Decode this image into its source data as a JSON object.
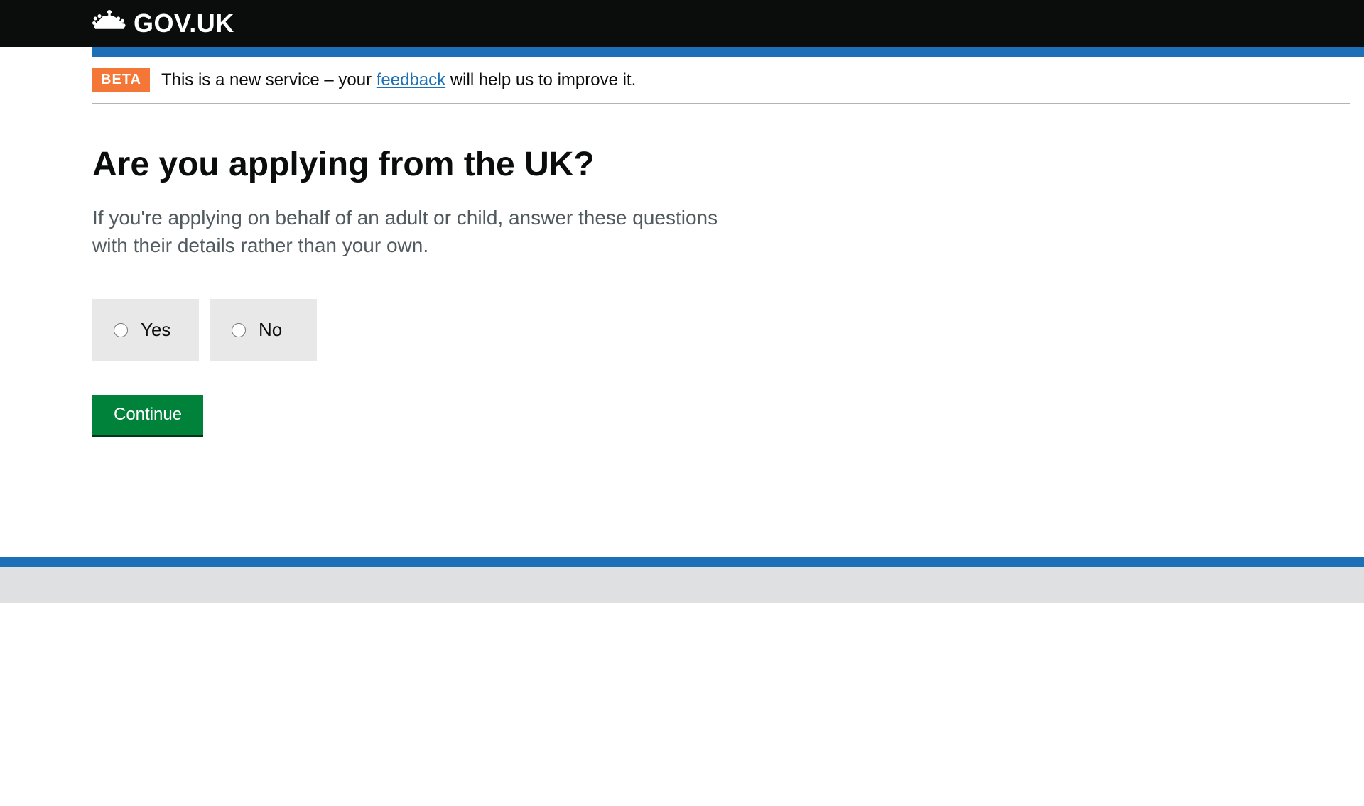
{
  "header": {
    "site_name": "GOV.UK"
  },
  "phase_banner": {
    "tag": "BETA",
    "text_before": "This is a new service – your ",
    "link_text": "feedback",
    "text_after": " will help us to improve it."
  },
  "main": {
    "heading": "Are you applying from the UK?",
    "hint": "If you're applying on behalf of an adult or child, answer these questions with their details rather than your own.",
    "options": {
      "yes": "Yes",
      "no": "No"
    },
    "continue_label": "Continue"
  }
}
